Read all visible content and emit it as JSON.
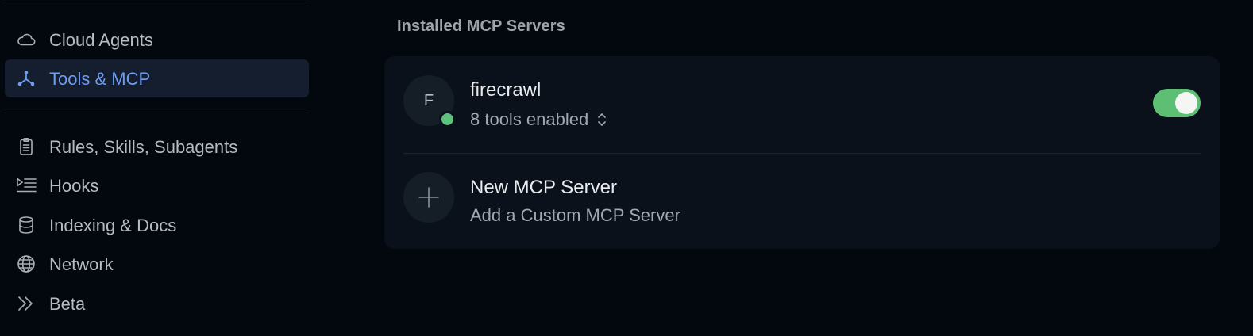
{
  "sidebar": {
    "items": [
      {
        "label": "Cloud Agents",
        "icon": "cloud-icon",
        "active": false
      },
      {
        "label": "Tools & MCP",
        "icon": "tools-mcp-icon",
        "active": true
      },
      {
        "label": "Rules, Skills, Subagents",
        "icon": "clipboard-icon",
        "active": false
      },
      {
        "label": "Hooks",
        "icon": "hooks-list-icon",
        "active": false
      },
      {
        "label": "Indexing & Docs",
        "icon": "database-icon",
        "active": false
      },
      {
        "label": "Network",
        "icon": "globe-icon",
        "active": false
      },
      {
        "label": "Beta",
        "icon": "double-chevron-right-icon",
        "active": false
      }
    ]
  },
  "main": {
    "section_title": "Installed MCP Servers",
    "servers": [
      {
        "initial": "F",
        "name": "firecrawl",
        "tools_label": "8 tools enabled",
        "enabled": true,
        "status": "connected"
      }
    ],
    "new_server": {
      "title": "New MCP Server",
      "subtitle": "Add a Custom MCP Server"
    }
  },
  "colors": {
    "background": "#03080f",
    "card": "#0a111b",
    "active_nav_bg": "#141e2f",
    "active_nav_text": "#6f9df2",
    "toggle_on": "#5cbf74",
    "status_dot": "#5dc27e"
  }
}
